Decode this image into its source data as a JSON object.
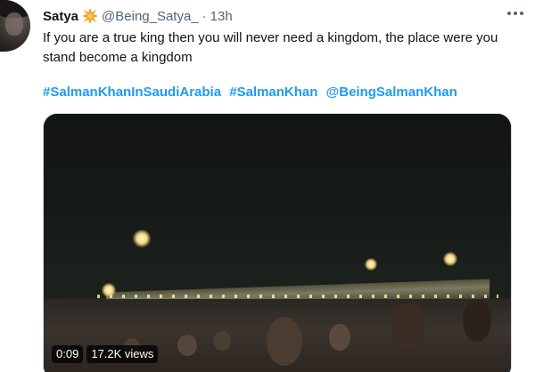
{
  "tweet": {
    "author_name": "Satya",
    "author_emoji_icon": "collision-emoji-icon",
    "handle": "@Being_Satya_",
    "separator": "·",
    "time": "13h",
    "text": "If you are a true king then you will never need a kingdom, the place were you stand become a kingdom",
    "hashtags": [
      "#SalmanKhanInSaudiArabia",
      "#SalmanKhan",
      "@BeingSalmanKhan"
    ],
    "more_icon": "more-options-icon"
  },
  "media": {
    "type": "video",
    "duration": "0:09",
    "views": "17.2K views"
  },
  "colors": {
    "link": "#1d9bf0",
    "secondary_text": "#536471",
    "primary_text": "#0f1419"
  }
}
